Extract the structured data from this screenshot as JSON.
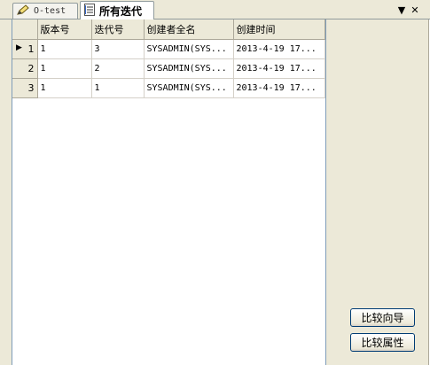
{
  "tabs": [
    {
      "label": "O-test",
      "icon": "pencil-icon"
    },
    {
      "label": "所有迭代",
      "icon": "list-icon"
    }
  ],
  "tabbar": {
    "dropdown_glyph": "▼",
    "close_glyph": "✕"
  },
  "grid": {
    "columns": [
      "版本号",
      "迭代号",
      "创建者全名",
      "创建时间"
    ],
    "rows": [
      {
        "index": "1",
        "current": true,
        "cells": [
          "1",
          "3",
          "SYSADMIN(SYS...",
          "2013-4-19 17..."
        ]
      },
      {
        "index": "2",
        "current": false,
        "cells": [
          "1",
          "2",
          "SYSADMIN(SYS...",
          "2013-4-19 17..."
        ]
      },
      {
        "index": "3",
        "current": false,
        "cells": [
          "1",
          "1",
          "SYSADMIN(SYS...",
          "2013-4-19 17..."
        ]
      }
    ]
  },
  "buttons": {
    "compare_wizard": "比较向导",
    "compare_properties": "比较属性"
  },
  "colors": {
    "background": "#ece9d8",
    "grid_background": "#ffffff",
    "button_border": "#003c74"
  }
}
